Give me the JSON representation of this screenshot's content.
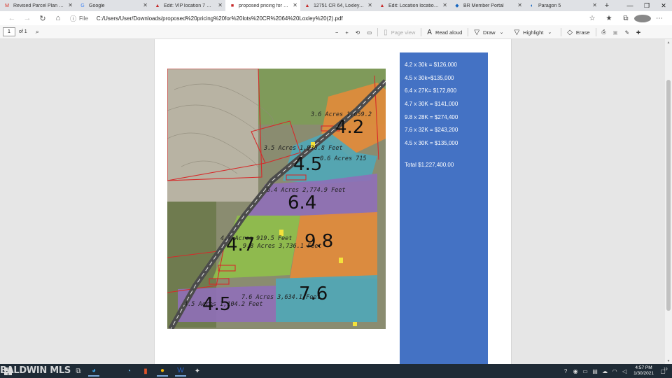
{
  "browser": {
    "tabs": [
      {
        "label": "Revised Parcel Plan - renee",
        "icon": "gmail-icon",
        "icon_glyph": "M",
        "color": "#d93025",
        "active": false
      },
      {
        "label": "Google",
        "icon": "google-icon",
        "icon_glyph": "G",
        "color": "#4285f4",
        "active": false
      },
      {
        "label": "Edit: VIP location 7 Estate lo",
        "icon": "realtor-icon",
        "icon_glyph": "▲",
        "color": "#c62828",
        "active": false
      },
      {
        "label": "proposed pricing for lots CR",
        "icon": "pdf-icon",
        "icon_glyph": "■",
        "color": "#c62828",
        "active": true
      },
      {
        "label": "12751 CR 64, Loxley, AL - W",
        "icon": "realtor-icon",
        "icon_glyph": "▲",
        "color": "#c62828",
        "active": false
      },
      {
        "label": "Edit: Location location 20 (M",
        "icon": "realtor-icon",
        "icon_glyph": "▲",
        "color": "#c62828",
        "active": false
      },
      {
        "label": "BR Member Portal",
        "icon": "portal-icon",
        "icon_glyph": "◆",
        "color": "#1565c0",
        "active": false
      },
      {
        "label": "Paragon 5",
        "icon": "paragon-icon",
        "icon_glyph": "◐",
        "color": "#1565c0",
        "active": false
      }
    ],
    "new_tab": "+",
    "window_controls": {
      "minimize": "—",
      "maximize": "❐",
      "close": "✕"
    },
    "address": {
      "info_icon": "ⓘ",
      "scheme": "File",
      "url": "C:/Users/User/Downloads/proposed%20pricing%20for%20lots%20CR%2064%20Loxley%20(2).pdf"
    }
  },
  "pdf_toolbar": {
    "page_number": "1",
    "page_of": "of 1",
    "tools": {
      "zoom_out": "−",
      "zoom_in": "+",
      "rotate": "⟲",
      "fit": "▭",
      "page_view": "Page view",
      "read_aloud": "Read aloud",
      "draw": "Draw",
      "highlight": "Highlight",
      "erase": "Erase"
    }
  },
  "document": {
    "price_lines": [
      "4.2 x 30k = $126,000",
      "4.5 x 30k=$135,000",
      "6.4 x 27K= $172,800",
      "4.7 x 30K = $141,000",
      "9.8 x 28K = $274,400",
      "7.6 x 32K = $243,200",
      "4.5 x 30K = $135,000"
    ],
    "total": "Total  $1,227,400.00",
    "map_labels": {
      "a": "3.6 Acres 1,659.2",
      "b": "3.5 Acres 1,936.8 Feet",
      "c": "0.6 Acres 715",
      "d": "6.4 Acres 2,774.9 Feet",
      "e": "4.7 Acres 919.5 Feet",
      "f": "9.8 Acres 3,736.1 Feet",
      "g": "7.6 Acres 3,634.1 Feet",
      "h": "4.5 Acres 1,104.2 Feet"
    },
    "hand_numbers": {
      "n1": "4.2",
      "n2": "4.5",
      "n3": "6.4",
      "n4": "4.7",
      "n5": "9.8",
      "n6": "7.6",
      "n7": "4.5"
    },
    "colors": {
      "price_box": "#4472c4",
      "orange_lot": "#e38b3a",
      "teal_lot": "#4fa7b8",
      "purple_lot": "#8f6fb8",
      "green_lot": "#8fbf4a"
    }
  },
  "taskbar": {
    "watermark": "BALDWIN MLS",
    "clock_time": "4:57 PM",
    "clock_date": "1/30/2021",
    "notification_count": "19"
  }
}
